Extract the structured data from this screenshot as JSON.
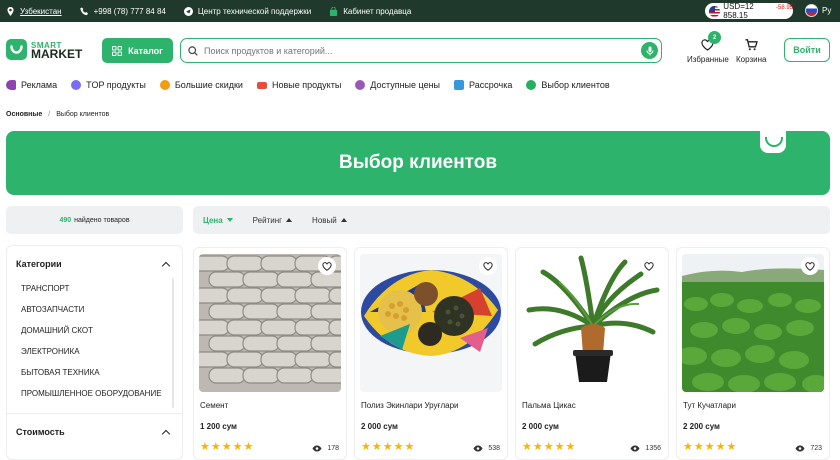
{
  "topbar": {
    "region": "Узбекистан",
    "phone": "+998 (78) 777 84 84",
    "support": "Центр технической поддержки",
    "seller": "Кабинет продавца",
    "currency_label": "USD=12 858.15",
    "currency_delta": "-58.95",
    "language": "Ру"
  },
  "logo": {
    "line1": "SMART",
    "line2": "MARKET"
  },
  "header": {
    "catalog_label": "Каталог",
    "search_placeholder": "Поиск продуктов и категорий...",
    "favorites_label": "Избранные",
    "favorites_count": "2",
    "cart_label": "Корзина",
    "login_label": "Войти"
  },
  "nav": [
    {
      "label": "Реклама",
      "icon": "megaphone-icon",
      "color": "#8e44ad"
    },
    {
      "label": "TOP продукты",
      "icon": "top-icon",
      "color": "#7b6cf6"
    },
    {
      "label": "Большие скидки",
      "icon": "discount-icon",
      "color": "#f39c12"
    },
    {
      "label": "Новые продукты",
      "icon": "new-icon",
      "color": "#e74c3c"
    },
    {
      "label": "Доступные цены",
      "icon": "price-icon",
      "color": "#9b59b6"
    },
    {
      "label": "Рассрочка",
      "icon": "installment-icon",
      "color": "#3498db"
    },
    {
      "label": "Выбор клиентов",
      "icon": "choice-icon",
      "color": "#27ae60"
    }
  ],
  "breadcrumb": {
    "home": "Основные",
    "separator": "/",
    "current": "Выбор клиентов"
  },
  "banner": {
    "title": "Выбор клиентов",
    "accent": "#2db36b"
  },
  "results": {
    "count": "490",
    "label": "найдено товаров"
  },
  "sort": [
    {
      "label": "Цена",
      "active": true
    },
    {
      "label": "Рейтинг",
      "active": false
    },
    {
      "label": "Новый",
      "active": false
    }
  ],
  "sidebar": {
    "categories_title": "Категории",
    "categories": [
      "Транспорт",
      "Автозапчасти",
      "Домашний скот",
      "Электроника",
      "Бытовая техника",
      "Промышленное оборудование"
    ],
    "price_title": "Стоимость"
  },
  "products": [
    {
      "name": "Семент",
      "price": "1 200 сум",
      "views": "178",
      "rating": 5
    },
    {
      "name": "Полиз Экинлари Уруғлари",
      "price": "2 000 сум",
      "views": "538",
      "rating": 5
    },
    {
      "name": "Пальма Цикас",
      "price": "2 000 сум",
      "views": "1356",
      "rating": 5
    },
    {
      "name": "Тут Кучатлари",
      "price": "2 200 сум",
      "views": "723",
      "rating": 5
    }
  ]
}
